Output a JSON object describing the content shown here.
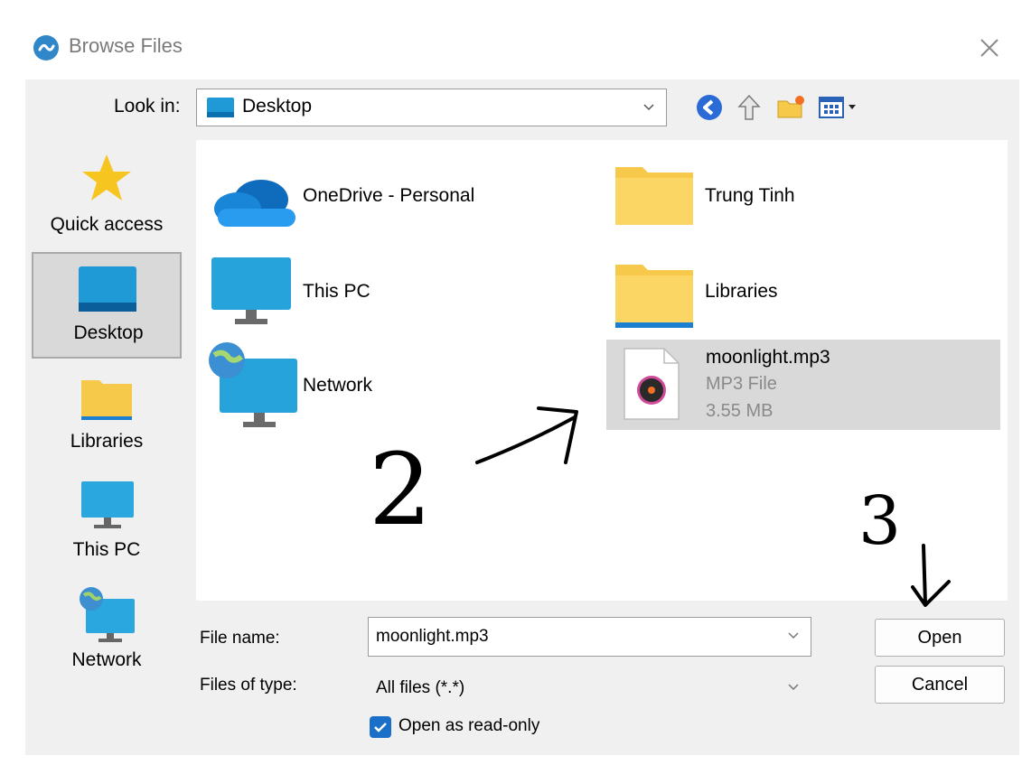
{
  "window": {
    "title": "Browse Files"
  },
  "toolbar": {
    "look_in_label": "Look in:",
    "look_in_value": "Desktop"
  },
  "places": [
    {
      "label": "Quick access",
      "icon": "star-icon"
    },
    {
      "label": "Desktop",
      "icon": "desktop-icon",
      "selected": true
    },
    {
      "label": "Libraries",
      "icon": "folder-icon"
    },
    {
      "label": "This PC",
      "icon": "computer-icon"
    },
    {
      "label": "Network",
      "icon": "network-icon"
    }
  ],
  "files": [
    {
      "name": "OneDrive - Personal",
      "icon": "onedrive-icon"
    },
    {
      "name": "Trung Tinh",
      "icon": "folder-icon"
    },
    {
      "name": "This PC",
      "icon": "computer-icon"
    },
    {
      "name": "Libraries",
      "icon": "folder-icon"
    },
    {
      "name": "Network",
      "icon": "network-icon"
    },
    {
      "name": "moonlight.mp3",
      "type": "MP3 File",
      "size": "3.55 MB",
      "icon": "music-file-icon",
      "selected": true
    }
  ],
  "form": {
    "file_name_label": "File name:",
    "file_name_value": "moonlight.mp3",
    "file_type_label": "Files of type:",
    "file_type_value": "All files (*.*)",
    "readonly_label": "Open as read-only",
    "readonly_checked": true
  },
  "buttons": {
    "open": "Open",
    "cancel": "Cancel"
  },
  "annotations": {
    "step2": "2",
    "step3": "3"
  },
  "colors": {
    "accent": "#1a6fc9",
    "selection": "#d9d9d9",
    "folder": "#f7c94b"
  }
}
